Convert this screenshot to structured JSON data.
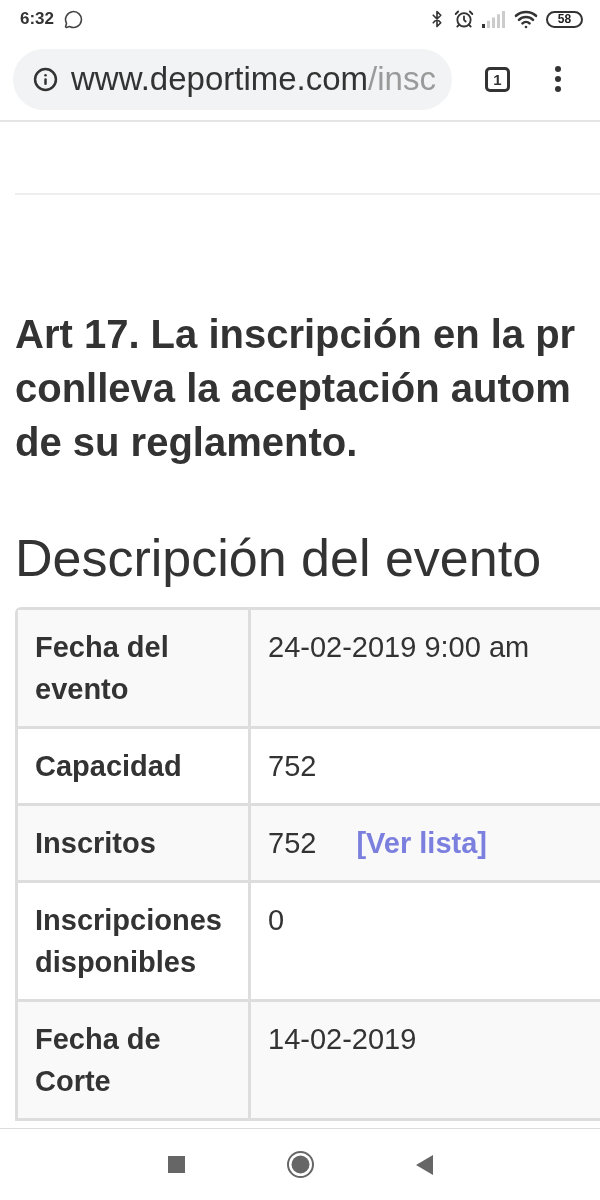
{
  "status_bar": {
    "time": "6:32",
    "battery": "58"
  },
  "browser_toolbar": {
    "url_host": "www.deportime.com",
    "url_path": "/insc",
    "tab_count": "1"
  },
  "article": {
    "lines": [
      "Art 17. La inscripción en la pr",
      "conlleva la aceptación autom",
      "de su reglamento."
    ]
  },
  "section_title": "Descripción del evento",
  "table": {
    "rows": [
      {
        "label": "Fecha del evento",
        "value": "24-02-2019 9:00 am"
      },
      {
        "label": "Capacidad",
        "value": "752"
      },
      {
        "label": "Inscritos",
        "value": "752",
        "link": "[Ver lista]"
      },
      {
        "label": "Inscripciones disponibles",
        "value": "0"
      },
      {
        "label": "Fecha de Corte",
        "value": "14-02-2019"
      }
    ]
  }
}
